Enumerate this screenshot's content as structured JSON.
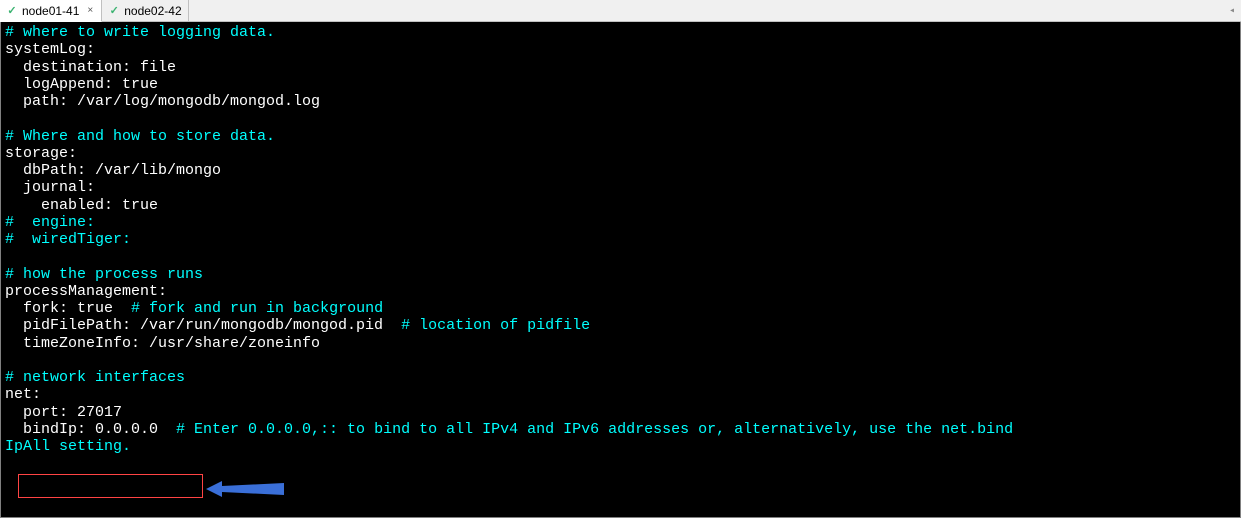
{
  "tabs": [
    {
      "label": "node01-41",
      "active": true,
      "closable": true
    },
    {
      "label": "node02-42",
      "active": false,
      "closable": false
    }
  ],
  "terminal_lines": [
    {
      "segments": [
        {
          "cls": "comment",
          "text": "# where to write logging data."
        }
      ]
    },
    {
      "segments": [
        {
          "cls": "key",
          "text": "systemLog:"
        }
      ]
    },
    {
      "segments": [
        {
          "cls": "key",
          "text": "  destination: file"
        }
      ]
    },
    {
      "segments": [
        {
          "cls": "key",
          "text": "  logAppend: true"
        }
      ]
    },
    {
      "segments": [
        {
          "cls": "key",
          "text": "  path: /var/log/mongodb/mongod.log"
        }
      ]
    },
    {
      "segments": [
        {
          "cls": "key",
          "text": ""
        }
      ]
    },
    {
      "segments": [
        {
          "cls": "comment",
          "text": "# Where and how to store data."
        }
      ]
    },
    {
      "segments": [
        {
          "cls": "key",
          "text": "storage:"
        }
      ]
    },
    {
      "segments": [
        {
          "cls": "key",
          "text": "  dbPath: /var/lib/mongo"
        }
      ]
    },
    {
      "segments": [
        {
          "cls": "key",
          "text": "  journal:"
        }
      ]
    },
    {
      "segments": [
        {
          "cls": "key",
          "text": "    enabled: true"
        }
      ]
    },
    {
      "segments": [
        {
          "cls": "comment",
          "text": "#  engine:"
        }
      ]
    },
    {
      "segments": [
        {
          "cls": "comment",
          "text": "#  wiredTiger:"
        }
      ]
    },
    {
      "segments": [
        {
          "cls": "key",
          "text": ""
        }
      ]
    },
    {
      "segments": [
        {
          "cls": "comment",
          "text": "# how the process runs"
        }
      ]
    },
    {
      "segments": [
        {
          "cls": "key",
          "text": "processManagement:"
        }
      ]
    },
    {
      "segments": [
        {
          "cls": "key",
          "text": "  fork: true  "
        },
        {
          "cls": "comment",
          "text": "# fork and run in background"
        }
      ]
    },
    {
      "segments": [
        {
          "cls": "key",
          "text": "  pidFilePath: /var/run/mongodb/mongod.pid  "
        },
        {
          "cls": "comment",
          "text": "# location of pidfile"
        }
      ]
    },
    {
      "segments": [
        {
          "cls": "key",
          "text": "  timeZoneInfo: /usr/share/zoneinfo"
        }
      ]
    },
    {
      "segments": [
        {
          "cls": "key",
          "text": ""
        }
      ]
    },
    {
      "segments": [
        {
          "cls": "comment",
          "text": "# network interfaces"
        }
      ]
    },
    {
      "segments": [
        {
          "cls": "key",
          "text": "net:"
        }
      ]
    },
    {
      "segments": [
        {
          "cls": "key",
          "text": "  port: 27017"
        }
      ]
    },
    {
      "segments": [
        {
          "cls": "key",
          "text": "  bindIp: 0.0.0.0  "
        },
        {
          "cls": "comment",
          "text": "# Enter 0.0.0.0,:: to bind to all IPv4 and IPv6 addresses or, alternatively, use the net.bind"
        }
      ]
    },
    {
      "segments": [
        {
          "cls": "comment",
          "text": "IpAll setting."
        }
      ]
    }
  ],
  "check_icon": "✓",
  "close_glyph": "×",
  "overflow_glyph": "◂"
}
